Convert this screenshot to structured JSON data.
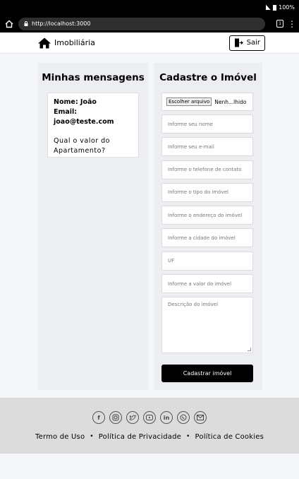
{
  "status_bar": {
    "battery": "100%"
  },
  "browser": {
    "url": "http://localhost:3000",
    "tab_count": "1"
  },
  "navbar": {
    "brand": "Imobiliária",
    "logout_label": "Sair"
  },
  "messages": {
    "title": "Minhas mensagens",
    "items": [
      {
        "name_line": "Nome: João",
        "email_label": "Email:",
        "email": "joao@teste.com",
        "question": "Qual o valor do Apartamento?"
      }
    ]
  },
  "form": {
    "title": "Cadastre o Imóvel",
    "file_button": "Escolher arquivo",
    "file_status": "Nenh...lhido",
    "fields": [
      "Informe seu nome",
      "Informe seu e-mail",
      "Informe o telefone de contato",
      "Informe o tipo do imóvel",
      "Informe o endereço do imóvel",
      "Informe a cidade do imóvel",
      "UF",
      "Informe a valor do imóvel"
    ],
    "description_placeholder": "Descrição do imóvel",
    "submit_label": "Cadastrar imóvel"
  },
  "footer": {
    "social_icons": [
      "facebook-icon",
      "instagram-icon",
      "twitter-icon",
      "youtube-icon",
      "linkedin-icon",
      "whatsapp-icon",
      "email-icon"
    ],
    "links": [
      "Termo de Uso",
      "Política de Privacidade",
      "Política de Cookies"
    ],
    "separator": "•"
  }
}
